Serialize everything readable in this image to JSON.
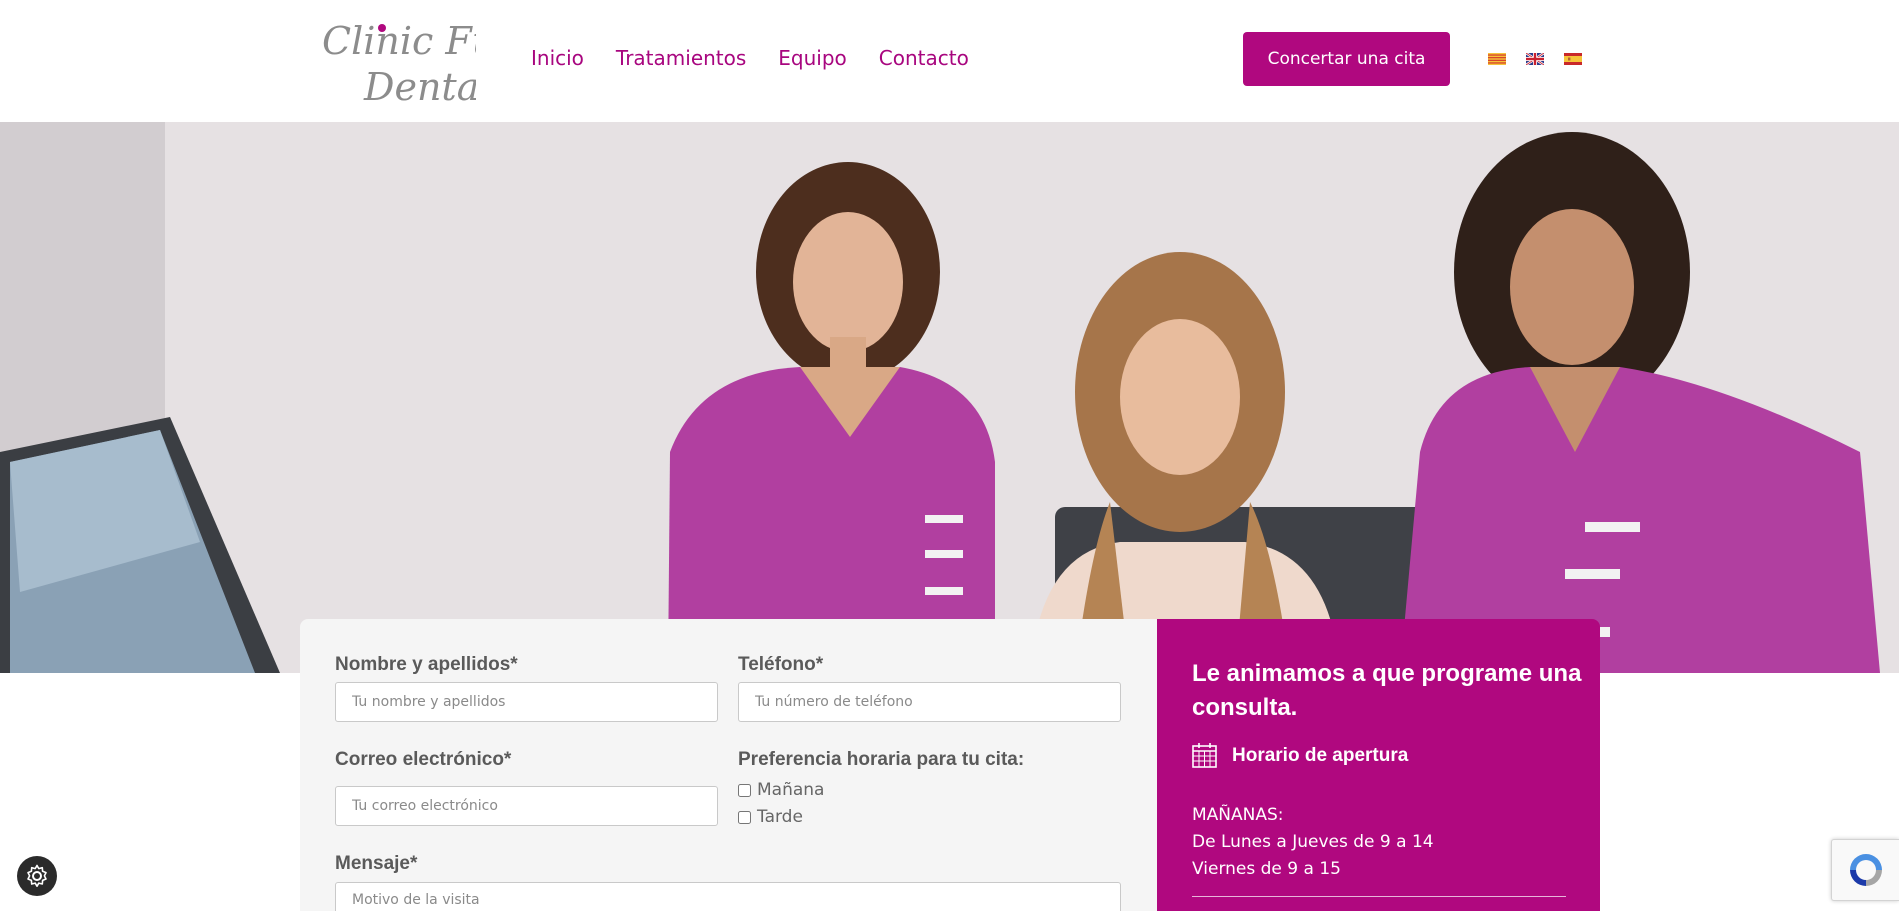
{
  "header": {
    "logo_alt": "Clinic Fur Dental",
    "logo_lines": [
      "Clinic Fur",
      "Dental"
    ],
    "nav": [
      {
        "label": "Inicio"
      },
      {
        "label": "Tratamientos"
      },
      {
        "label": "Equipo"
      },
      {
        "label": "Contacto"
      }
    ],
    "cta_label": "Concertar una cita",
    "languages": [
      "catalan-flag-icon",
      "uk-flag-icon",
      "spain-flag-icon"
    ]
  },
  "form": {
    "name_label": "Nombre y apellidos*",
    "name_placeholder": "Tu nombre y apellidos",
    "phone_label": "Teléfono*",
    "phone_placeholder": "Tu número de teléfono",
    "email_label": "Correo electrónico*",
    "email_placeholder": "Tu correo electrónico",
    "pref_label": "Preferencia horaria para tu cita:",
    "pref_options": [
      {
        "label": "Mañana",
        "checked": false
      },
      {
        "label": "Tarde",
        "checked": false
      }
    ],
    "message_label": "Mensaje*",
    "message_placeholder": "Motivo de la visita"
  },
  "info": {
    "title": "Le animamos a que programe una consulta.",
    "hours_icon": "calendar-icon",
    "hours_title": "Horario de apertura",
    "hours_lines": [
      "MAÑANAS:",
      "De Lunes a Jueves de 9 a 14",
      "Viernes de 9 a 15"
    ]
  },
  "widgets": {
    "cookie_icon": "gear-icon",
    "recaptcha_icon": "recaptcha-icon"
  },
  "colors": {
    "brand": "#b0087f",
    "nav_text": "#a8067f",
    "form_bg": "#f5f5f5",
    "label_text": "#5a5a5a"
  }
}
